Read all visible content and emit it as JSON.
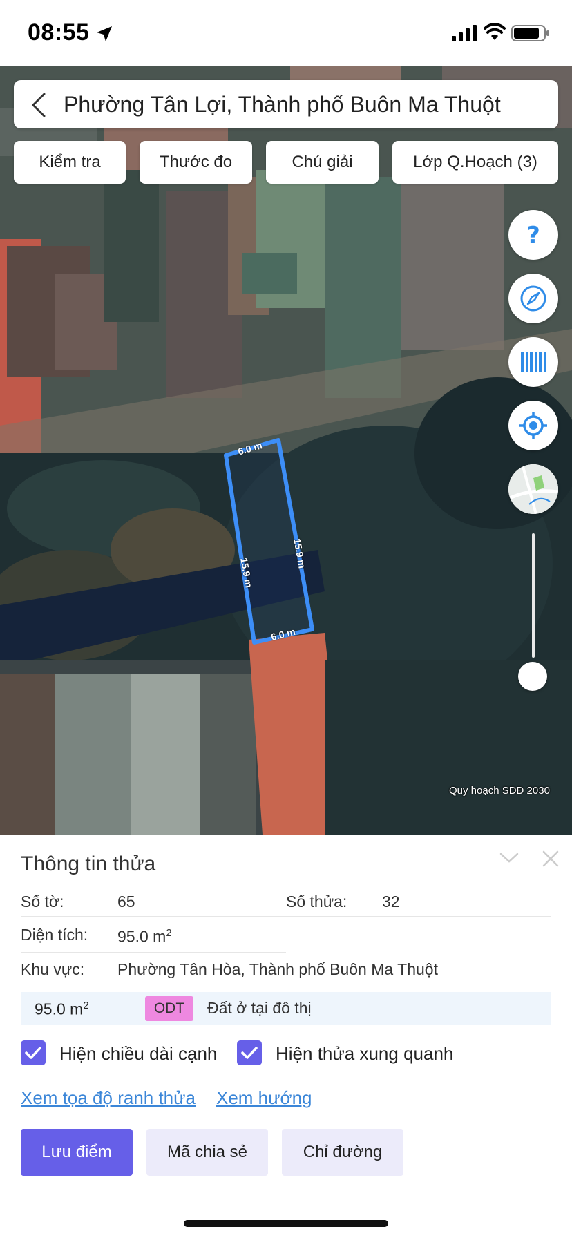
{
  "status_bar": {
    "time": "08:55"
  },
  "search": {
    "text": "Phường Tân Lợi, Thành phố Buôn Ma Thuột"
  },
  "chips": [
    "Kiểm tra",
    "Thước đo",
    "Chú giải",
    "Lớp Q.Hoạch (3)"
  ],
  "map_buttons": [
    "help-icon",
    "compass-icon",
    "barcode-icon",
    "locate-icon",
    "map-thumbnail-icon"
  ],
  "parcel_labels": {
    "top": "6.0 m",
    "bottom": "6.0 m",
    "left": "15.9 m",
    "right": "15.9 m"
  },
  "attribution": "Quy hoạch SDĐ 2030",
  "colors": {
    "accent": "#665fe8",
    "link": "#3b86d8",
    "parcel_outline": "#3d8ef7",
    "land_code_bg": "#ee88e0"
  },
  "panel": {
    "title": "Thông tin thửa",
    "sheet_label": "Số tờ:",
    "sheet_value": "65",
    "parcel_label": "Số thửa:",
    "parcel_value": "32",
    "area_label": "Diện tích:",
    "area_value": "95.0 m",
    "area_unit_sup": "2",
    "region_label": "Khu vực:",
    "region_value": "Phường Tân Hòa, Thành phố Buôn Ma Thuột",
    "land_use": {
      "area": "95.0 m",
      "area_sup": "2",
      "code": "ODT",
      "description": "Đất ở tại đô thị"
    },
    "checkboxes": [
      {
        "label": "Hiện chiều dài cạnh",
        "checked": true
      },
      {
        "label": "Hiện thửa xung quanh",
        "checked": true
      }
    ],
    "links": [
      "Xem tọa độ ranh thửa",
      "Xem hướng"
    ],
    "buttons": [
      "Lưu điểm",
      "Mã chia sẻ",
      "Chỉ đường"
    ]
  }
}
